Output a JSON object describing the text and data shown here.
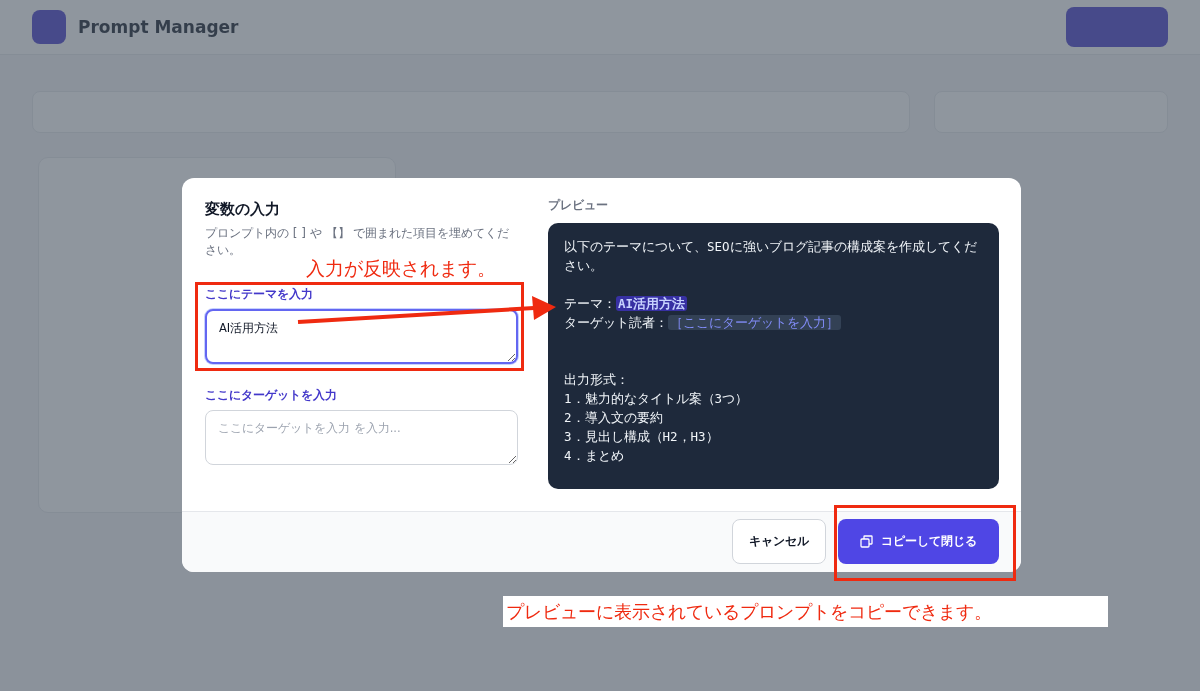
{
  "app": {
    "title": "Prompt Manager"
  },
  "dialog": {
    "title": "変数の入力",
    "description": "プロンプト内の [ ] や 【】 で囲まれた項目を埋めてください。",
    "variables": [
      {
        "label": "ここにテーマを入力",
        "value": "AI活用方法",
        "focused": true
      },
      {
        "label": "ここにターゲットを入力",
        "placeholder": "ここにターゲットを入力 を入力...",
        "focused": false
      }
    ],
    "preview_label": "プレビュー",
    "preview": [
      [
        [
          {
            "text": "以下のテーマについて、SEOに強いブログ記事の構成案を作成してください。",
            "kind": "plain"
          }
        ]
      ],
      [
        [
          {
            "text": "テーマ：",
            "kind": "plain"
          },
          {
            "text": "AI活用方法",
            "kind": "filled"
          }
        ],
        [
          {
            "text": "ターゲット読者：",
            "kind": "plain"
          },
          {
            "text": "［ここにターゲットを入力］",
            "kind": "empty"
          }
        ]
      ],
      [
        [
          {
            "text": "出力形式：",
            "kind": "plain"
          }
        ],
        [
          {
            "text": "1．魅力的なタイトル案（3つ）",
            "kind": "plain"
          }
        ],
        [
          {
            "text": "2．導入文の要約",
            "kind": "plain"
          }
        ],
        [
          {
            "text": "3．見出し構成（H2，H3）",
            "kind": "plain"
          }
        ],
        [
          {
            "text": "4．まとめ",
            "kind": "plain"
          }
        ]
      ]
    ],
    "buttons": [
      {
        "label": "キャンセル",
        "kind": "secondary"
      },
      {
        "label": "コピーして閉じる",
        "kind": "primary"
      }
    ]
  },
  "annotations": {
    "input_note": "入力が反映されます。",
    "copy_note": "プレビューに表示されているプロンプトをコピーできます。"
  }
}
